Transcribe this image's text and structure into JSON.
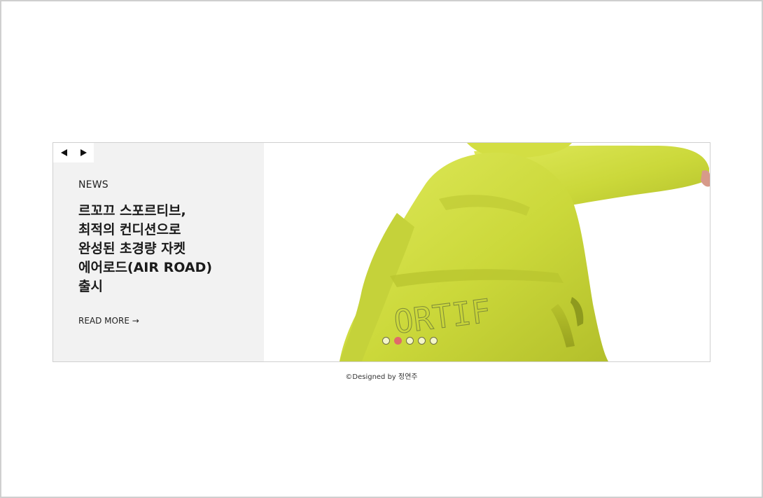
{
  "slider": {
    "prev_icon": "triangle-left-icon",
    "next_icon": "triangle-right-icon",
    "category": "NEWS",
    "headline_lines": [
      "르꼬끄 스포르티브,",
      "최적의 컨디션으로",
      "완성된 초경량 자켓",
      "에어로드(AIR ROAD)",
      "출시"
    ],
    "read_more": "READ MORE →",
    "image_print_text": "ORTIF",
    "dots": {
      "count": 5,
      "active_index": 1
    },
    "colors": {
      "panel_bg": "#f2f2f2",
      "jacket": "#cfdc3a",
      "active_dot": "#e06a6a"
    }
  },
  "footer": {
    "credit": "©Designed by 정연주"
  }
}
